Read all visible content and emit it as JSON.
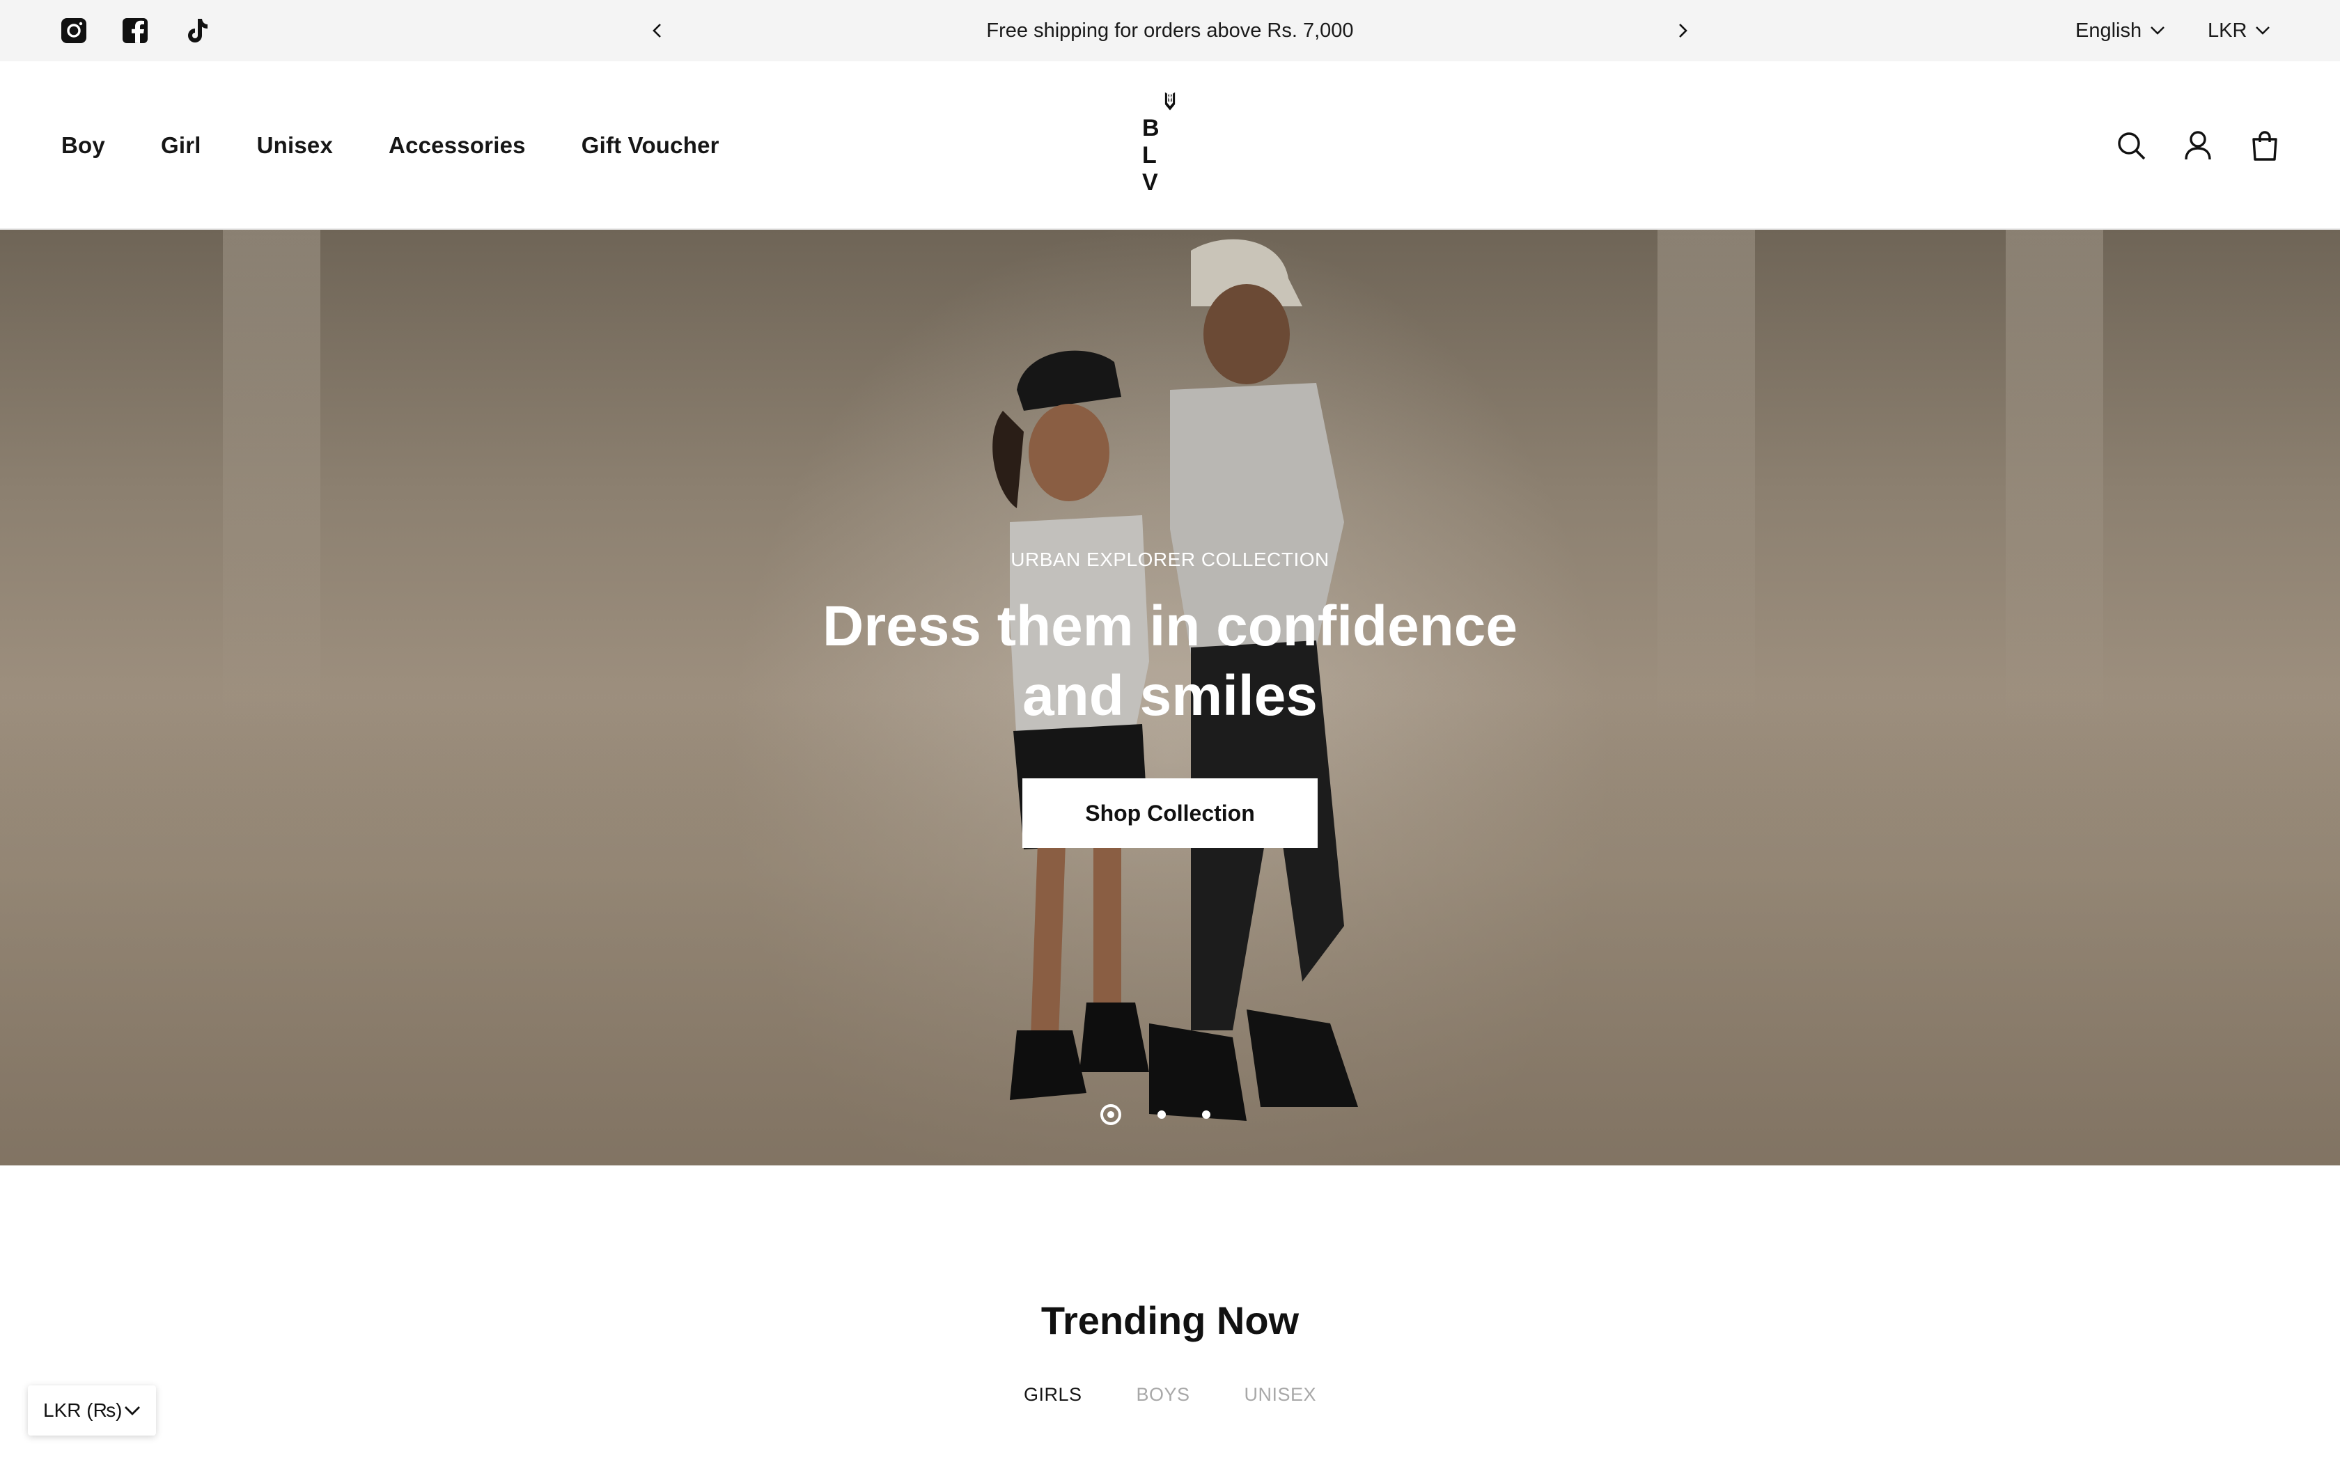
{
  "announcement": {
    "message": "Free shipping for orders above Rs. 7,000",
    "language": "English",
    "currency": "LKR",
    "social": [
      {
        "name": "Instagram",
        "icon": "instagram-icon"
      },
      {
        "name": "Facebook",
        "icon": "facebook-icon"
      },
      {
        "name": "TikTok",
        "icon": "tiktok-icon"
      }
    ]
  },
  "header": {
    "nav": [
      "Boy",
      "Girl",
      "Unisex",
      "Accessories",
      "Gift Voucher"
    ],
    "logo_text": "B L V",
    "icons": [
      "search-icon",
      "account-icon",
      "cart-icon"
    ]
  },
  "hero": {
    "eyebrow": "URBAN EXPLORER COLLECTION",
    "headline": "Dress them in confidence and smiles",
    "cta": "Shop Collection",
    "slide_count": 3,
    "active_slide": 1
  },
  "trending": {
    "title": "Trending Now",
    "tabs": [
      "GIRLS",
      "BOYS",
      "UNISEX"
    ],
    "active_tab": "GIRLS"
  },
  "currency_widget": {
    "label": "LKR (₨)"
  },
  "colors": {
    "announcement_bg": "#f4f4f4",
    "text": "#111111",
    "inactive_tab": "#a8a8a8",
    "hero_wall": "#8c8070"
  }
}
